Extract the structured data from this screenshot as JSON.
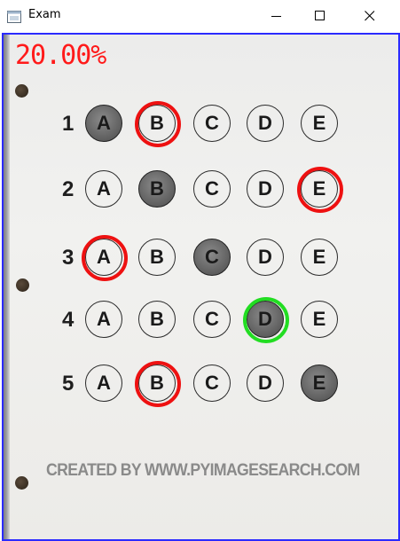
{
  "window": {
    "title": "Exam",
    "controls": {
      "minimize": "minimize",
      "maximize": "maximize",
      "close": "close"
    }
  },
  "exam": {
    "score_text": "20.00%",
    "footer_text": "CREATED BY WWW.PYIMAGESEARCH.COM",
    "colors": {
      "correct_ring": "#22dd22",
      "wrong_ring": "#ee1111",
      "score": "#ff1a1a"
    },
    "options": [
      "A",
      "B",
      "C",
      "D",
      "E"
    ],
    "questions": [
      {
        "number": "1",
        "filled": "A",
        "ring": {
          "option": "B",
          "color": "red"
        }
      },
      {
        "number": "2",
        "filled": "B",
        "ring": {
          "option": "E",
          "color": "red"
        }
      },
      {
        "number": "3",
        "filled": "C",
        "ring": {
          "option": "A",
          "color": "red"
        }
      },
      {
        "number": "4",
        "filled": "D",
        "ring": {
          "option": "D",
          "color": "green"
        }
      },
      {
        "number": "5",
        "filled": "E",
        "ring": {
          "option": "B",
          "color": "red"
        }
      }
    ]
  }
}
